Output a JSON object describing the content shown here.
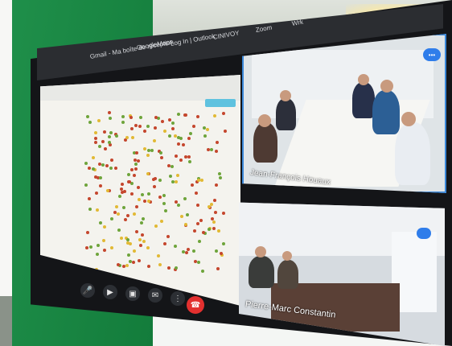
{
  "browser": {
    "tabs": [
      "Gmail - Ma boîte de réception",
      "GoogleMaps",
      "Log In | Outlook",
      "CINIVOY",
      "Zoom",
      "Wrk"
    ]
  },
  "video_call": {
    "participants": [
      {
        "name": "Jean-François Houaux"
      },
      {
        "name": "Pierre-Marc Constantin"
      }
    ],
    "controls": [
      "mic",
      "camera",
      "share",
      "chat",
      "more",
      "hang-up"
    ]
  }
}
